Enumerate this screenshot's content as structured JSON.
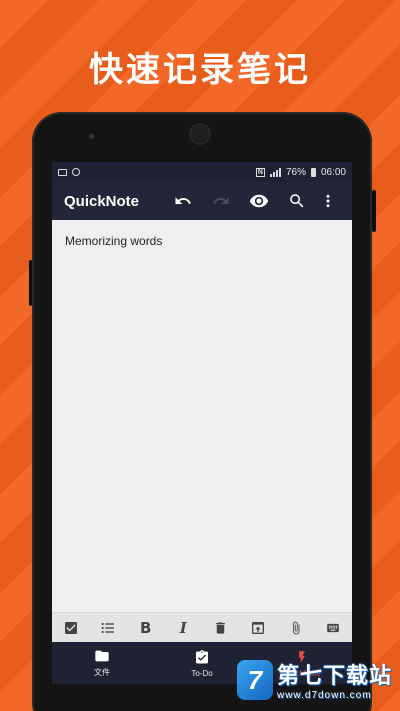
{
  "headline": "快速记录笔记",
  "status_bar": {
    "battery": "76%",
    "time": "06:00"
  },
  "app_bar": {
    "title": "QuickNote",
    "actions": [
      "undo-icon",
      "redo-icon",
      "eye-icon",
      "search-icon",
      "more-vertical-icon"
    ]
  },
  "editor": {
    "content": "Memorizing words"
  },
  "format_bar": {
    "bold_label": "B",
    "italic_label": "I",
    "icons": [
      "checkbox-icon",
      "list-icon",
      "bold-icon",
      "italic-icon",
      "trash-icon",
      "upload-icon",
      "attachment-icon",
      "keyboard-icon"
    ]
  },
  "bottom_nav": {
    "items": [
      {
        "label": "文件",
        "icon": "folder-icon"
      },
      {
        "label": "To-Do",
        "icon": "clipboard-check-icon"
      },
      {
        "label": "QuickNote",
        "icon": "lightning-icon"
      }
    ]
  },
  "watermark": {
    "logo_letter": "7",
    "name": "第七下载站",
    "url": "www.d7down.com"
  },
  "colors": {
    "background": "#f0601c",
    "app_bar": "#232638",
    "accent": "#e84c3d",
    "editor": "#efefef"
  }
}
